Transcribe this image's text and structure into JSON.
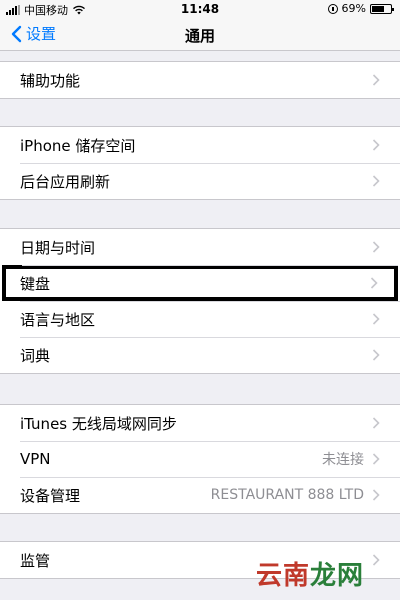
{
  "status_bar": {
    "carrier": "中国移动",
    "time": "11:48",
    "battery": "69%",
    "battery_level": 0.69
  },
  "nav": {
    "back_label": "设置",
    "title": "通用"
  },
  "groups": [
    {
      "rows": [
        {
          "label": "辅助功能"
        }
      ]
    },
    {
      "rows": [
        {
          "label": "iPhone 储存空间"
        },
        {
          "label": "后台应用刷新"
        }
      ]
    },
    {
      "rows": [
        {
          "label": "日期与时间"
        },
        {
          "label": "键盘",
          "highlighted": true
        },
        {
          "label": "语言与地区"
        },
        {
          "label": "词典"
        }
      ]
    },
    {
      "rows": [
        {
          "label": "iTunes 无线局域网同步"
        },
        {
          "label": "VPN",
          "value": "未连接"
        },
        {
          "label": "设备管理",
          "value": "RESTAURANT 888 LTD"
        }
      ]
    },
    {
      "rows": [
        {
          "label": "监管"
        }
      ]
    }
  ],
  "watermark": {
    "part1": "云南",
    "part2": "龙网"
  },
  "colors": {
    "accent": "#007aff",
    "background": "#efeff4",
    "secondary_text": "#8e8e93"
  },
  "icons": [
    "back-chevron-icon",
    "disclosure-chevron-icon",
    "wifi-icon",
    "battery-icon",
    "orientation-lock-icon",
    "signal-icon"
  ]
}
